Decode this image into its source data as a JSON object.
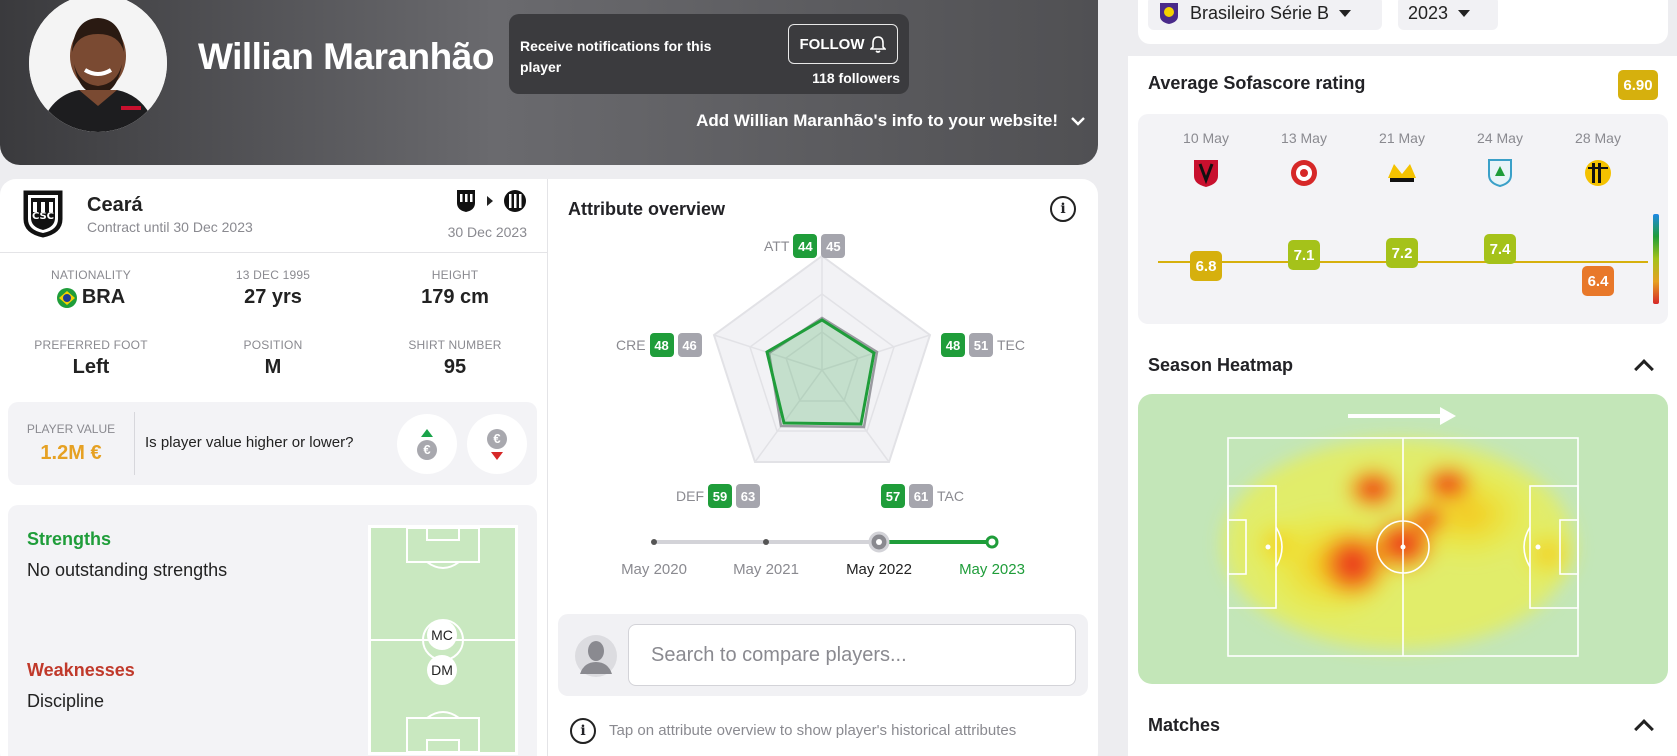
{
  "header": {
    "player_name": "Willian Maranhão",
    "notify_text": "Receive notifications for this player",
    "follow_label": "FOLLOW",
    "followers": "118 followers",
    "embed_text": "Add Willian Maranhão's info to your website!"
  },
  "club": {
    "name": "Ceará",
    "contract": "Contract until 30 Dec 2023",
    "transfer_date": "30 Dec 2023"
  },
  "details": [
    {
      "label": "NATIONALITY",
      "value": "BRA"
    },
    {
      "label": "13 DEC 1995",
      "value": "27 yrs"
    },
    {
      "label": "HEIGHT",
      "value": "179 cm"
    },
    {
      "label": "PREFERRED FOOT",
      "value": "Left"
    },
    {
      "label": "POSITION",
      "value": "M"
    },
    {
      "label": "SHIRT NUMBER",
      "value": "95"
    }
  ],
  "player_value": {
    "label": "PLAYER VALUE",
    "amount": "1.2M €",
    "question": "Is player value higher or lower?"
  },
  "strengths": {
    "title": "Strengths",
    "text": "No outstanding strengths",
    "weak_title": "Weaknesses",
    "weak_text": "Discipline",
    "positions": [
      "MC",
      "DM"
    ]
  },
  "attributes": {
    "title": "Attribute overview",
    "items": [
      {
        "key": "ATT",
        "current": "44",
        "previous": "45"
      },
      {
        "key": "TEC",
        "current": "48",
        "previous": "51"
      },
      {
        "key": "TAC",
        "current": "57",
        "previous": "61"
      },
      {
        "key": "DEF",
        "current": "59",
        "previous": "63"
      },
      {
        "key": "CRE",
        "current": "48",
        "previous": "46"
      }
    ],
    "timeline": [
      "May 2020",
      "May 2021",
      "May 2022",
      "May 2023"
    ],
    "search_placeholder": "Search to compare players...",
    "hint": "Tap on attribute overview to show player's historical attributes"
  },
  "selectors": {
    "league": "Brasileiro Série B",
    "season": "2023"
  },
  "rating": {
    "title": "Average Sofascore rating",
    "average": "6.90",
    "matches": [
      {
        "date": "10 May",
        "rating": "6.8",
        "color": "#d6b00d"
      },
      {
        "date": "13 May",
        "rating": "7.1",
        "color": "#a5c21a"
      },
      {
        "date": "21 May",
        "rating": "7.2",
        "color": "#a5c21a"
      },
      {
        "date": "24 May",
        "rating": "7.4",
        "color": "#a5c21a"
      },
      {
        "date": "28 May",
        "rating": "6.4",
        "color": "#e8782a"
      }
    ]
  },
  "heatmap": {
    "title": "Season Heatmap"
  },
  "matches": {
    "title": "Matches"
  },
  "colors": {
    "green": "#1f9d3a",
    "gold": "#e6a123",
    "red": "#c0392b"
  }
}
